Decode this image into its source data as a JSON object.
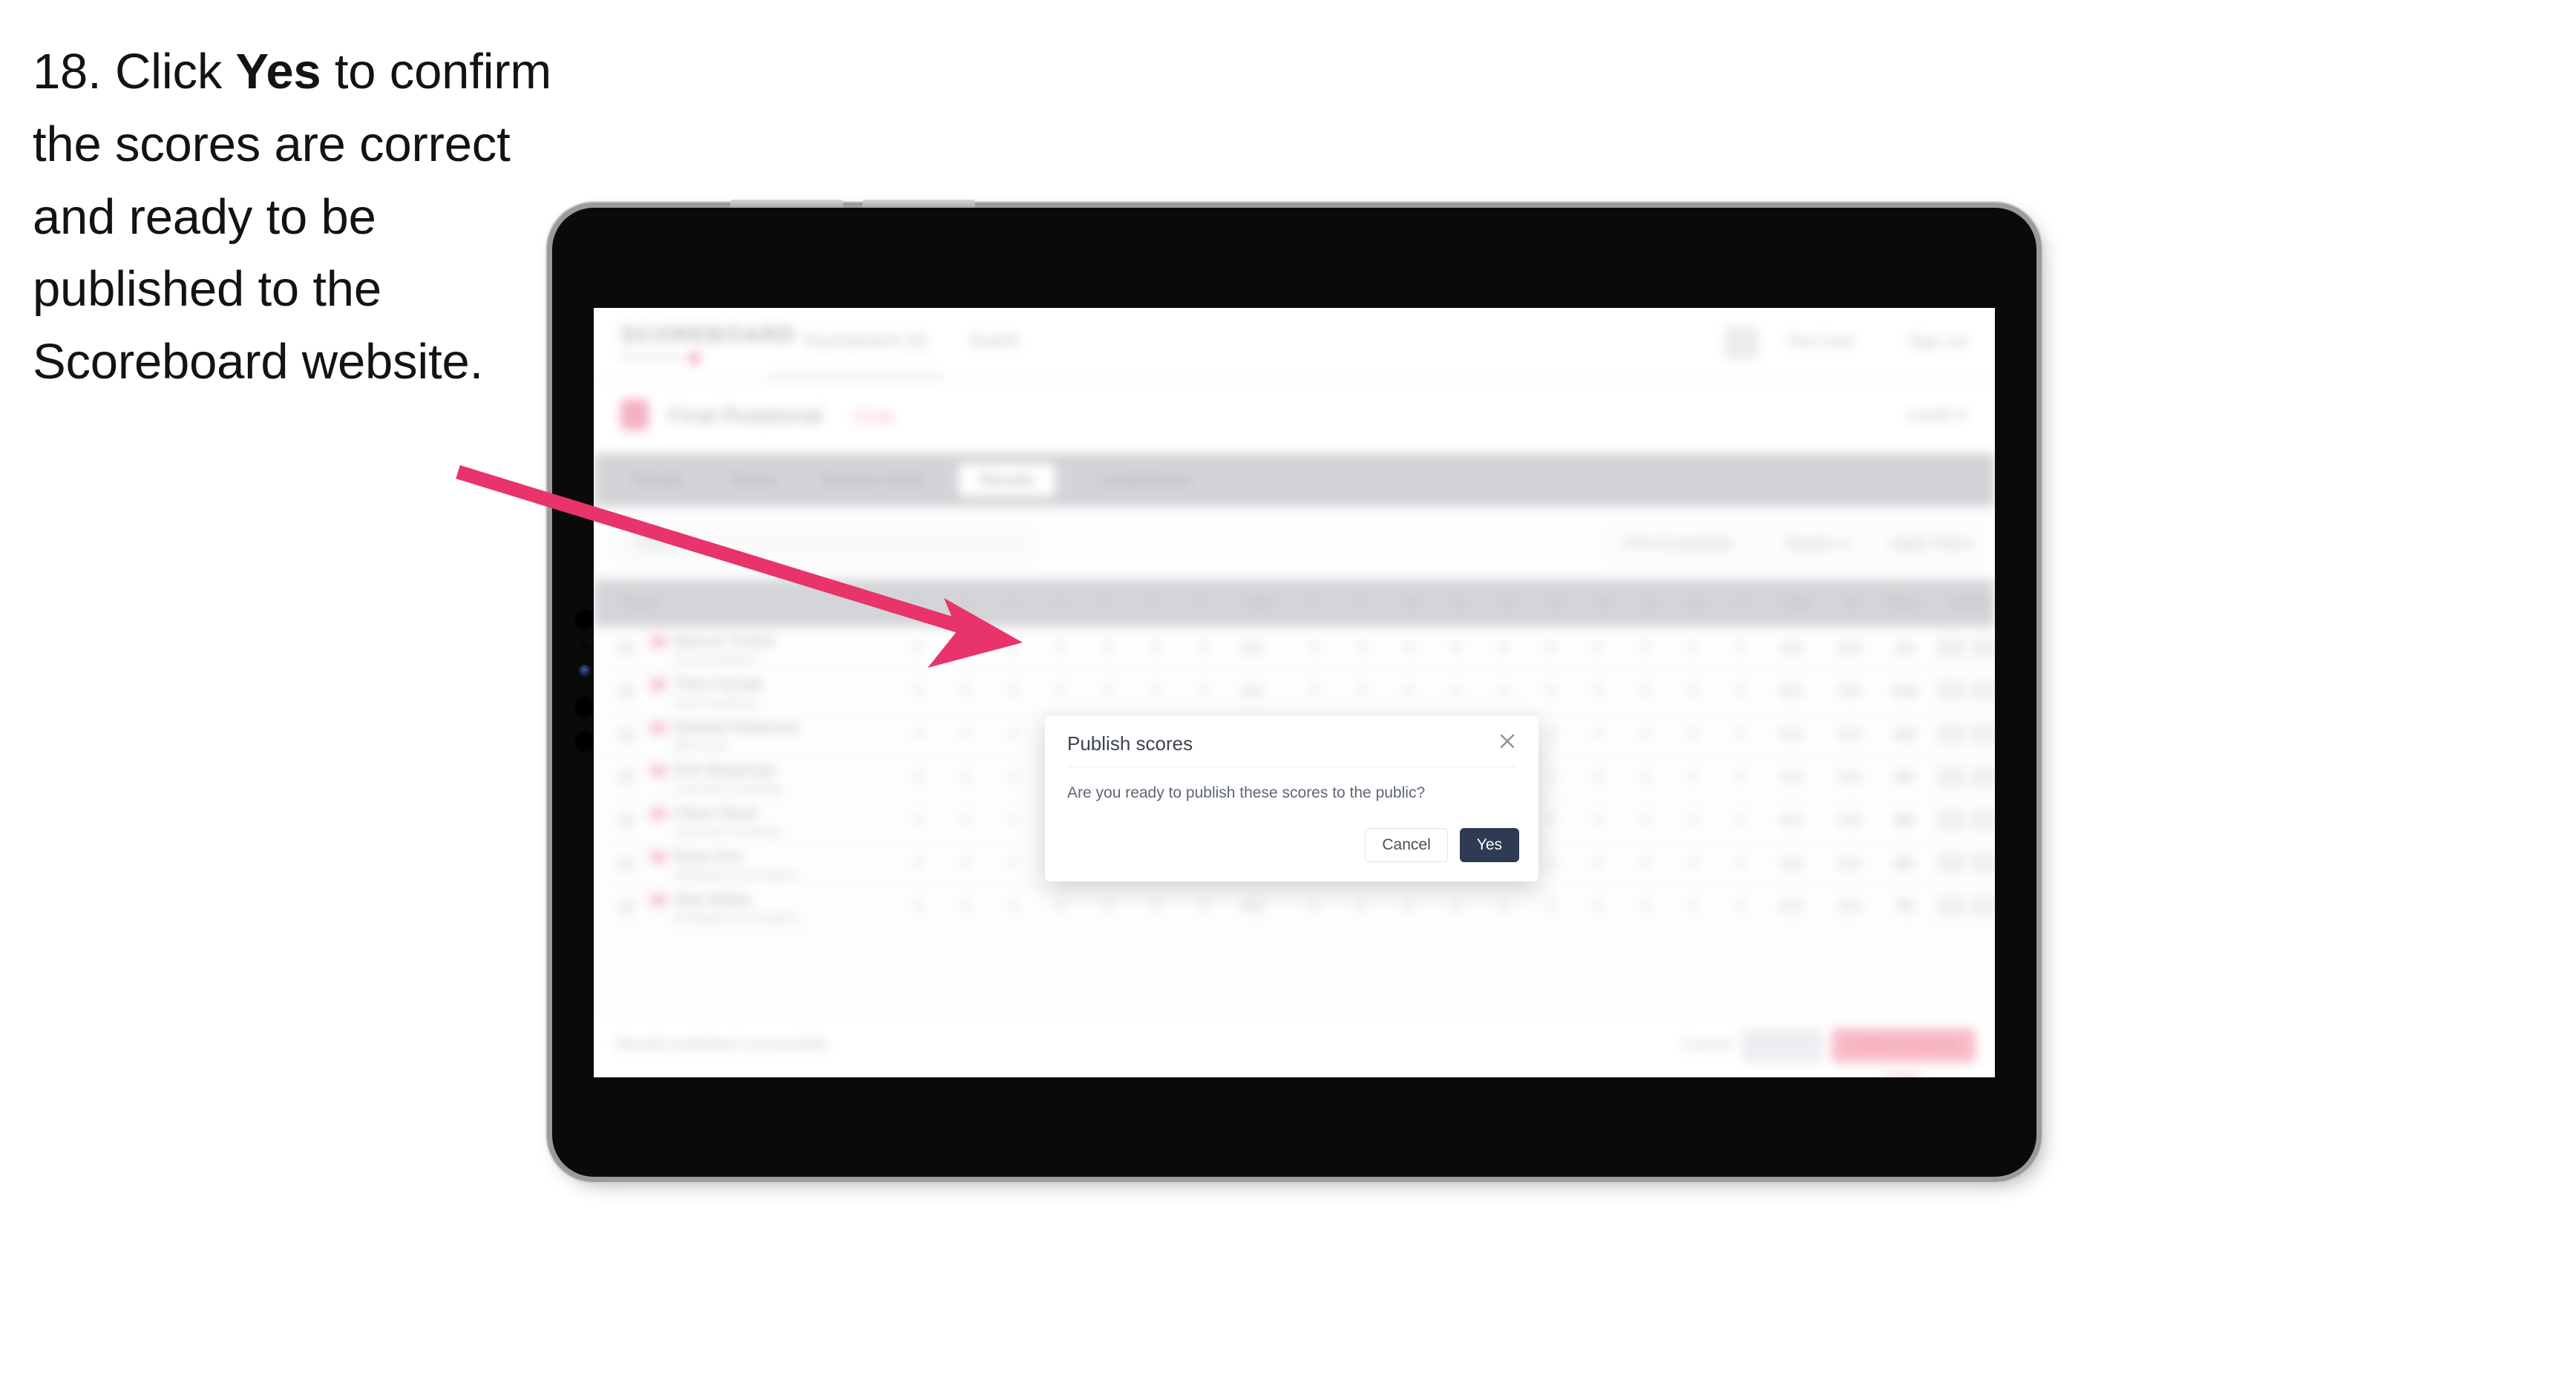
{
  "caption": {
    "step_number": "18.",
    "text_before": "Click",
    "bold_word": "Yes",
    "text_after": "to confirm the scores are correct and ready to be published to the Scoreboard website."
  },
  "annotation": {
    "arrow_color": "#E8346A",
    "points_to": "yes-button"
  },
  "device": {
    "type": "tablet",
    "body_color": "#0a0a0a",
    "bezel_color": "#9b9b9b",
    "buttons": [
      "volume-up",
      "volume-down"
    ]
  },
  "app": {
    "header": {
      "logo": "SCOREBOARD",
      "sub": "Powered by",
      "nav": [
        "Tournament (4)",
        "Event"
      ],
      "user": "Test User",
      "sign_out": "Sign out"
    },
    "title_bar": {
      "title": "Final Rotational",
      "accent": "Club",
      "right": "Level 4"
    },
    "tabs": [
      {
        "label": "Details",
        "active": false
      },
      {
        "label": "Teams",
        "active": false
      },
      {
        "label": "Session Order",
        "active": false
      },
      {
        "label": "Results",
        "active": true
      },
      {
        "label": "Leaderboard",
        "active": false
      }
    ],
    "filters": {
      "search_placeholder": "Search",
      "controls": [
        "Print Scoresheet",
        "Session 1",
        "Apply Filters"
      ]
    },
    "table": {
      "columns": [
        "Player",
        "1",
        "2",
        "3",
        "4",
        "5",
        "6",
        "7",
        "Total",
        "8",
        "9",
        "10",
        "11",
        "12",
        "13",
        "14",
        "15",
        "16",
        "17",
        "Total",
        "AA",
        "Place",
        "Update"
      ],
      "rows": [
        {
          "name": "Marcus Tucker",
          "club": "Gym Academy",
          "scores": [
            "0",
            "0",
            "0",
            "0",
            "0",
            "0",
            "0"
          ],
          "total": "0.0",
          "scores2": [
            "0",
            "0",
            "0",
            "0",
            "0",
            "0",
            "0",
            "0",
            "0",
            "0"
          ],
          "total2": "0.0",
          "aa": "0.0",
          "place": "1st"
        },
        {
          "name": "Theo Parsak",
          "club": "Gym Academy",
          "scores": [
            "0",
            "0",
            "0",
            "0",
            "0",
            "0",
            "0"
          ],
          "total": "0.0",
          "scores2": [
            "0",
            "0",
            "0",
            "0",
            "0",
            "0",
            "0",
            "0",
            "0",
            "0"
          ],
          "total2": "0.0",
          "aa": "0.0",
          "place": "2nd"
        },
        {
          "name": "Deleted Roberson",
          "club": "Elite Gym",
          "scores": [
            "0",
            "0",
            "0",
            "0",
            "0",
            "0",
            "0"
          ],
          "total": "0.0",
          "scores2": [
            "0",
            "0",
            "0",
            "0",
            "0",
            "0",
            "0",
            "0",
            "0",
            "0"
          ],
          "total2": "0.0",
          "aa": "0.0",
          "place": "3rd"
        },
        {
          "name": "Erik Malacinan",
          "club": "Lakeview Tumbling",
          "scores": [
            "0",
            "0",
            "0",
            "0",
            "0",
            "0",
            "0"
          ],
          "total": "0.0",
          "scores2": [
            "0",
            "0",
            "0",
            "0",
            "0",
            "0",
            "0",
            "0",
            "0",
            "0"
          ],
          "total2": "0.0",
          "aa": "0.0",
          "place": "4th"
        },
        {
          "name": "Oliver Reed",
          "club": "Lakeview Tumbling",
          "scores": [
            "0",
            "0",
            "0",
            "0",
            "0",
            "0",
            "0"
          ],
          "total": "0.0",
          "scores2": [
            "0",
            "0",
            "0",
            "0",
            "0",
            "0",
            "0",
            "0",
            "0",
            "0"
          ],
          "total2": "0.0",
          "aa": "0.0",
          "place": "5th"
        },
        {
          "name": "Ryan Kim",
          "club": "Northgate Gymnastics",
          "scores": [
            "0",
            "0",
            "0",
            "0",
            "0",
            "0",
            "0"
          ],
          "total": "0.0",
          "scores2": [
            "0",
            "0",
            "0",
            "0",
            "0",
            "0",
            "0",
            "0",
            "0",
            "0"
          ],
          "total2": "0.0",
          "aa": "0.0",
          "place": "6th"
        },
        {
          "name": "Nick Bailey",
          "club": "Northgate Gymnastics",
          "scores": [
            "0",
            "0",
            "0",
            "0",
            "0",
            "0",
            "0"
          ],
          "total": "0.0",
          "scores2": [
            "0",
            "0",
            "0",
            "0",
            "0",
            "0",
            "0",
            "0",
            "0",
            "0"
          ],
          "total2": "0.0",
          "aa": "0.0",
          "place": "7th"
        }
      ]
    },
    "footer": {
      "note": "Results published successfully",
      "link": "Cancel",
      "secondary_button": "Save All",
      "primary_button": "Publish Scores to Public"
    }
  },
  "modal": {
    "title": "Publish scores",
    "body": "Are you ready to publish these scores to the public?",
    "cancel_label": "Cancel",
    "yes_label": "Yes",
    "close_icon": "close-icon",
    "yes_color": "#2f3b52"
  }
}
